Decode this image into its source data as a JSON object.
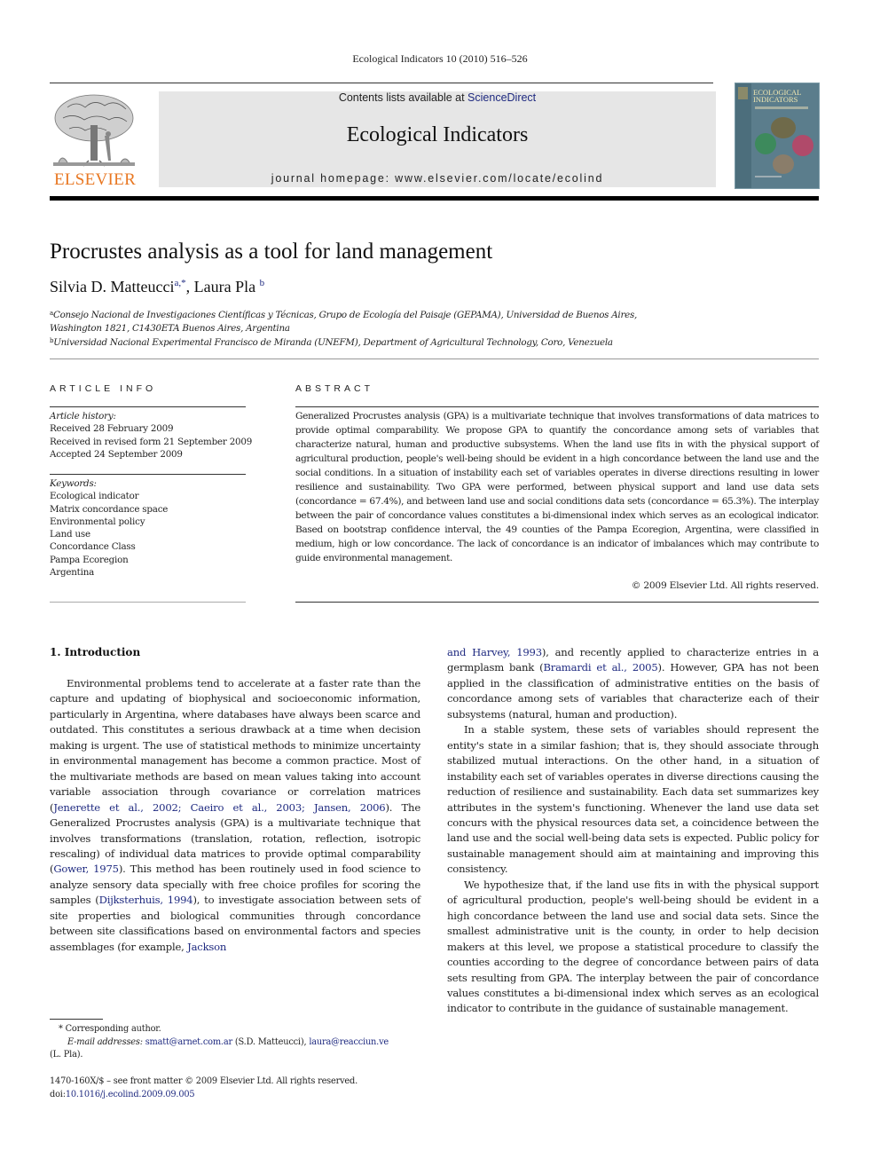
{
  "running_header": "Ecological Indicators 10 (2010) 516–526",
  "publisher": {
    "logo_text": "ELSEVIER",
    "logo_color": "#e87722"
  },
  "banner": {
    "contents_prefix": "Contents lists available at ",
    "contents_link": "ScienceDirect",
    "journal_title": "Ecological Indicators",
    "homepage_label": "journal homepage: ",
    "homepage_url": "www.elsevier.com/locate/ecolind"
  },
  "cover": {
    "title_line1": "ECOLOGICAL",
    "title_line2": "INDICATORS"
  },
  "article": {
    "title": "Procrustes analysis as a tool for land management",
    "authors": [
      {
        "name": "Silvia D. Matteucci",
        "marks": "a,*"
      },
      {
        "name": "Laura Pla",
        "marks": "b"
      }
    ],
    "author_separator": ", ",
    "affiliations": [
      {
        "mark": "a",
        "text": "Consejo Nacional de Investigaciones Científicas y Técnicas, Grupo de Ecología del Paisaje (GEPAMA), Universidad de Buenos Aires,",
        "text2": "Washington 1821, C1430ETA Buenos Aires, Argentina"
      },
      {
        "mark": "b",
        "text": "Universidad Nacional Experimental Francisco de Miranda (UNEFM), Department of Agricultural Technology, Coro, Venezuela"
      }
    ]
  },
  "article_info": {
    "heading": "ARTICLE INFO",
    "history_label": "Article history:",
    "history": [
      "Received 28 February 2009",
      "Received in revised form 21 September 2009",
      "Accepted 24 September 2009"
    ],
    "keywords_label": "Keywords:",
    "keywords": [
      "Ecological indicator",
      "Matrix concordance space",
      "Environmental policy",
      "Land use",
      "Concordance Class",
      "Pampa Ecoregion",
      "Argentina"
    ]
  },
  "abstract": {
    "heading": "ABSTRACT",
    "text": "Generalized Procrustes analysis (GPA) is a multivariate technique that involves transformations of data matrices to provide optimal comparability. We propose GPA to quantify the concordance among sets of variables that characterize natural, human and productive subsystems. When the land use fits in with the physical support of agricultural production, people's well-being should be evident in a high concordance between the land use and the social conditions. In a situation of instability each set of variables operates in diverse directions resulting in lower resilience and sustainability. Two GPA were performed, between physical support and land use data sets (concordance = 67.4%), and between land use and social conditions data sets (concordance = 65.3%). The interplay between the pair of concordance values constitutes a bi-dimensional index which serves as an ecological indicator. Based on bootstrap confidence interval, the 49 counties of the Pampa Ecoregion, Argentina, were classified in medium, high or low concordance. The lack of concordance is an indicator of imbalances which may contribute to guide environmental management.",
    "copyright": "© 2009 Elsevier Ltd. All rights reserved."
  },
  "introduction": {
    "heading": "1.  Introduction",
    "p1": [
      {
        "t": "Environmental problems tend to accelerate at a faster rate than the capture and updating of biophysical and socioeconomic information, particularly in Argentina, where databases have always been scarce and outdated. This constitutes a serious drawback at a time when decision making is urgent. The use of statistical methods to minimize uncertainty in environmental management has become a common practice. Most of the multivariate methods are based on mean values taking into account variable association through covariance or correlation matrices ("
      },
      {
        "l": "Jenerette et al., 2002; Caeiro et al., 2003; Jansen, 2006"
      },
      {
        "t": "). The Generalized Procrustes analysis (GPA) is a multivariate technique that involves transformations (translation, rotation, reflection, isotropic rescaling) of individual data matrices to provide optimal comparability ("
      },
      {
        "l": "Gower, 1975"
      },
      {
        "t": "). This method has been routinely used in food science to analyze sensory data specially with free choice profiles for scoring the samples ("
      },
      {
        "l": "Dijksterhuis, 1994"
      },
      {
        "t": "), to investigate association between sets of site properties and biological communities through concordance between site classifications based on environmental factors and species assemblages (for example, "
      },
      {
        "l": "Jackson and Harvey, 1993"
      },
      {
        "t": "), and recently applied to characterize entries in a germplasm bank ("
      },
      {
        "l": "Bramardi et al., 2005"
      },
      {
        "t": "). However, GPA has not been applied in the classification of administrative entities on the basis of concordance among sets of variables that characterize each of their subsystems (natural, human and production)."
      }
    ],
    "p2": "In a stable system, these sets of variables should represent the entity's state in a similar fashion; that is, they should associate through stabilized mutual interactions. On the other hand, in a situation of instability each set of variables operates in diverse directions causing the reduction of resilience and sustainability. Each data set summarizes key attributes in the system's functioning. Whenever the land use data set concurs with the physical resources data set, a coincidence between the land use and the social well-being data sets is expected. Public policy for sustainable management should aim at maintaining and improving this consistency.",
    "p3": "We hypothesize that, if the land use fits in with the physical support of agricultural production, people's well-being should be evident in a high concordance between the land use and social data sets. Since the smallest administrative unit is the county, in order to help decision makers at this level, we propose a statistical procedure to classify the counties according to the degree of concordance between pairs of data sets resulting from GPA. The interplay between the pair of concordance values constitutes a bi-dimensional index which serves as an ecological indicator to contribute in the guidance of sustainable management."
  },
  "footnotes": {
    "corresponding": "* Corresponding author.",
    "email_label": "E-mail addresses: ",
    "email1": "smatt@arnet.com.ar",
    "email1_owner": " (S.D. Matteucci), ",
    "email2": "laura@reacciun.ve",
    "email2_owner": "(L. Pla)."
  },
  "front_matter": {
    "issn_line": "1470-160X/$ – see front matter © 2009 Elsevier Ltd. All rights reserved.",
    "doi_label": "doi:",
    "doi": "10.1016/j.ecolind.2009.09.005"
  },
  "colors": {
    "link": "#1f2a80",
    "banner_bg": "#e6e6e6",
    "logo_orange": "#e87722"
  }
}
